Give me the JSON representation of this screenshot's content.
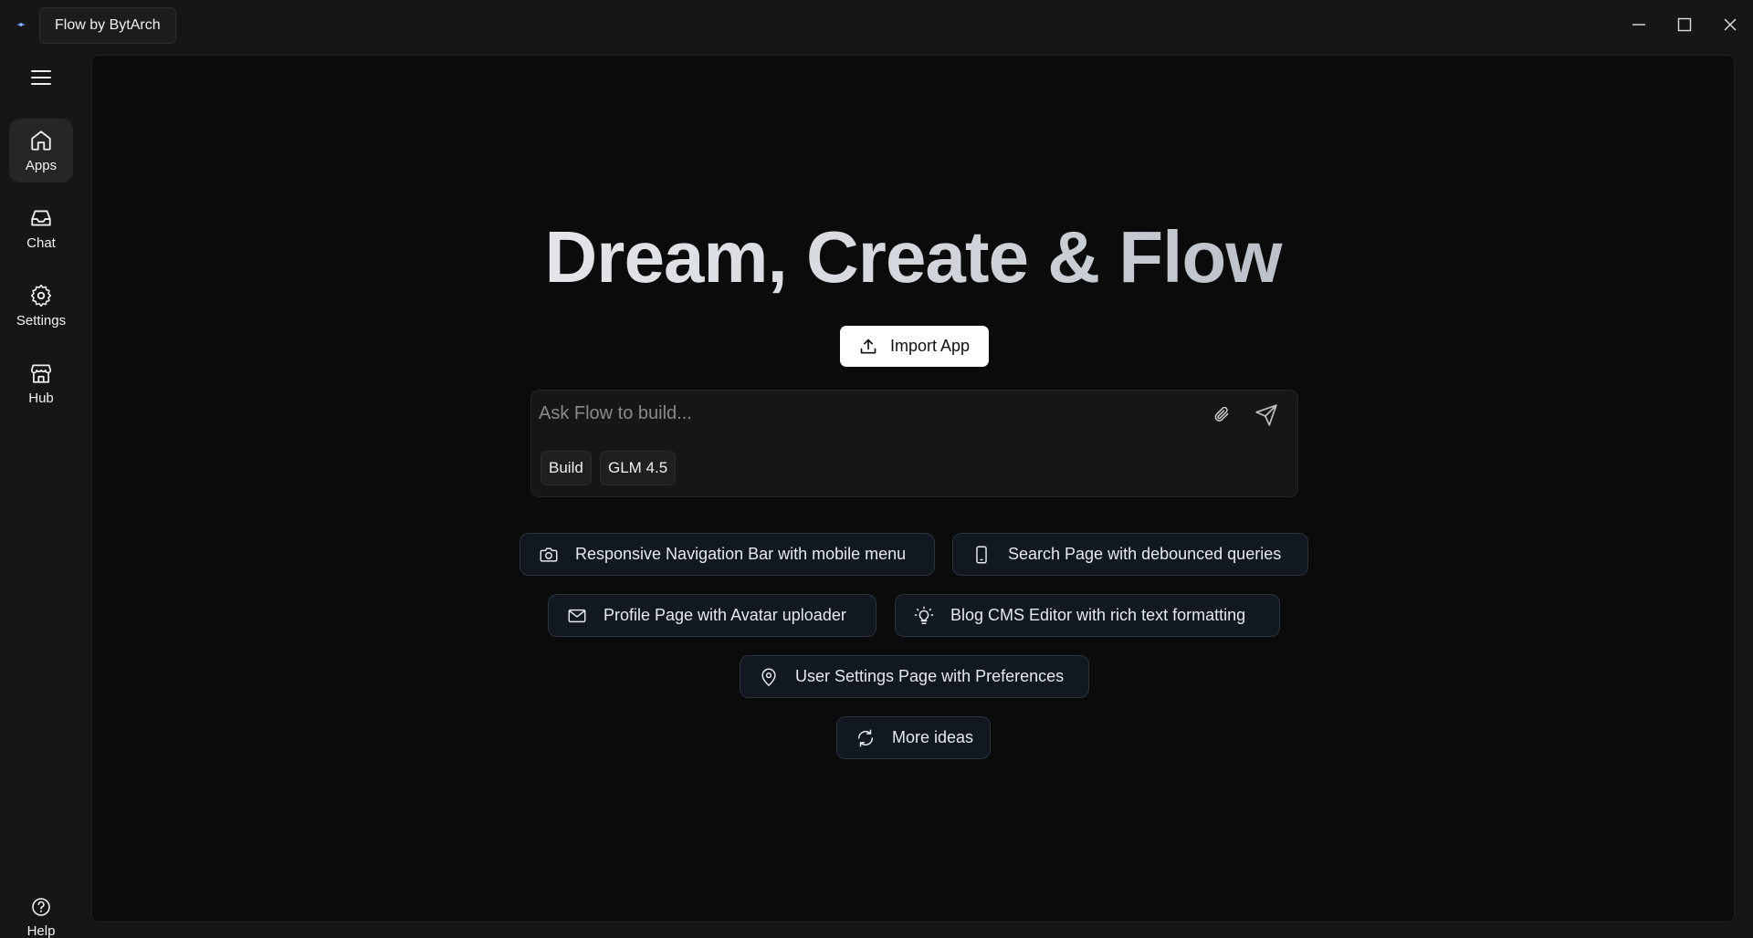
{
  "window": {
    "title": "Flow by BytArch"
  },
  "sidebar": {
    "items": [
      {
        "label": "Apps",
        "icon": "home-icon",
        "active": true
      },
      {
        "label": "Chat",
        "icon": "inbox-icon",
        "active": false
      },
      {
        "label": "Settings",
        "icon": "gear-icon",
        "active": false
      },
      {
        "label": "Hub",
        "icon": "store-icon",
        "active": false
      }
    ],
    "help": {
      "label": "Help",
      "icon": "help-circle-icon"
    }
  },
  "main": {
    "headline": "Dream, Create & Flow",
    "import_label": "Import App",
    "prompt": {
      "placeholder": "Ask Flow to build...",
      "mode": "Build",
      "model": "GLM 4.5"
    },
    "ideas": [
      {
        "label": "Responsive Navigation Bar with mobile menu",
        "icon": "camera-icon"
      },
      {
        "label": "Search Page with debounced queries",
        "icon": "smartphone-icon"
      },
      {
        "label": "Profile Page with Avatar uploader",
        "icon": "mail-icon"
      },
      {
        "label": "Blog CMS Editor with rich text formatting",
        "icon": "lightbulb-icon"
      },
      {
        "label": "User Settings Page with Preferences",
        "icon": "map-pin-icon"
      },
      {
        "label": "More ideas",
        "icon": "refresh-icon"
      }
    ]
  }
}
